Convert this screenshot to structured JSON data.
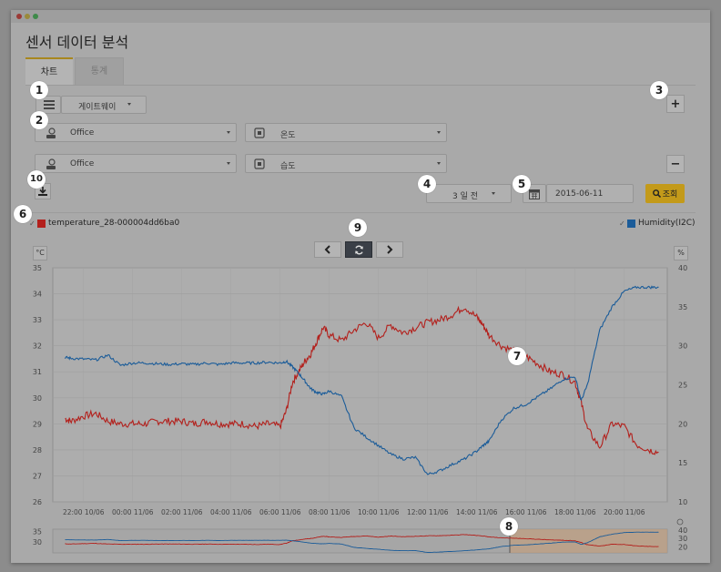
{
  "page": {
    "title": "센서 데이터 분석"
  },
  "tabs": [
    {
      "label": "차트"
    },
    {
      "label": "통계"
    }
  ],
  "toolbar": {
    "gateway_label": "게이트웨이",
    "add_label": "+",
    "remove_label": "−",
    "period_label": "3 일 전",
    "date_value": "2015-06-11",
    "query_label": "조회"
  },
  "series_selectors": [
    {
      "location": "Office",
      "measure": "온도"
    },
    {
      "location": "Office",
      "measure": "습도"
    }
  ],
  "badges": {
    "b1": "1",
    "b2": "2",
    "b3": "3",
    "b4": "4",
    "b5": "5",
    "b6": "6",
    "b7": "7",
    "b8": "8",
    "b9": "9",
    "b10": "10"
  },
  "legend": {
    "left": {
      "name": "temperature_28-000004dd6ba0",
      "color": "#c0201f",
      "checked": true
    },
    "right": {
      "name": "Humidity(I2C)",
      "color": "#1f5f9e",
      "checked": true
    }
  },
  "axes": {
    "left_unit": "°C",
    "right_unit": "%"
  },
  "colors": {
    "accent": "#d7a81b",
    "temperature": "#b3201c",
    "humidity": "#1b5c99",
    "navigator_highlight": "#c89d74"
  },
  "chart_data": {
    "type": "line",
    "x_ticks": [
      "22:00 10/06",
      "00:00 11/06",
      "02:00 11/06",
      "04:00 11/06",
      "06:00 11/06",
      "08:00 11/06",
      "10:00 11/06",
      "12:00 11/06",
      "14:00 11/06",
      "16:00 11/06",
      "18:00 11/06",
      "20:00 11/06"
    ],
    "y_left": {
      "label": "°C",
      "ticks": [
        26,
        27,
        28,
        29,
        30,
        31,
        32,
        33,
        34,
        35
      ],
      "range": [
        26,
        35
      ]
    },
    "y_right": {
      "label": "%",
      "ticks": [
        10,
        15,
        20,
        25,
        30,
        35,
        40
      ],
      "range": [
        10,
        40
      ]
    },
    "x_hours": [
      21.25,
      21.5,
      22,
      22.5,
      23,
      23.5,
      0,
      0.5,
      1,
      1.5,
      2,
      2.5,
      3,
      3.5,
      4,
      4.5,
      5,
      5.5,
      6,
      6.25,
      6.5,
      6.75,
      7,
      7.25,
      7.5,
      7.75,
      8,
      8.5,
      9,
      9.5,
      10,
      10.5,
      11,
      11.5,
      12,
      12.5,
      13,
      13.5,
      14,
      14.25,
      14.5,
      15,
      15.5,
      16,
      16.5,
      17,
      17.5,
      18,
      18.25,
      18.5,
      19,
      19.5,
      20,
      20.5,
      21,
      21.4
    ],
    "series": [
      {
        "name": "temperature_28-000004dd6ba0",
        "axis": "left",
        "color": "#b3201c",
        "values": [
          29.2,
          29.1,
          29.3,
          29.4,
          29.1,
          29.0,
          29.0,
          29.0,
          29.1,
          29.1,
          29.1,
          29.0,
          29.1,
          29.0,
          29.0,
          29.0,
          28.9,
          29.0,
          28.9,
          29.5,
          30.6,
          31.0,
          31.4,
          31.7,
          32.2,
          32.7,
          32.4,
          32.2,
          32.6,
          32.9,
          32.3,
          32.8,
          32.5,
          32.7,
          32.9,
          33.0,
          33.2,
          33.5,
          33.1,
          32.8,
          32.4,
          32.0,
          31.8,
          31.6,
          31.3,
          31.0,
          30.9,
          30.6,
          29.8,
          28.8,
          28.1,
          29.0,
          28.9,
          28.2,
          28.0,
          27.9
        ]
      },
      {
        "name": "Humidity(I2C)",
        "axis": "right",
        "color": "#1b5c99",
        "values": [
          28.5,
          28.4,
          28.3,
          28.2,
          28.8,
          27.5,
          27.8,
          27.8,
          27.7,
          27.6,
          27.7,
          27.6,
          27.8,
          27.6,
          27.8,
          27.8,
          27.8,
          27.9,
          27.8,
          28.0,
          27.3,
          26.5,
          25.5,
          24.5,
          24.0,
          23.8,
          24.2,
          23.5,
          19.5,
          18.3,
          17.2,
          16.1,
          15.5,
          15.7,
          13.5,
          14.0,
          14.8,
          15.5,
          16.5,
          17.2,
          17.8,
          20.5,
          22.0,
          22.5,
          23.5,
          24.5,
          25.7,
          26.0,
          23.0,
          25.0,
          32.0,
          35.0,
          37.0,
          37.5,
          37.5,
          37.5
        ]
      }
    ],
    "navigator": {
      "left_ticks": [
        30,
        35
      ],
      "right_ticks": [
        20,
        30,
        40
      ]
    },
    "grid": true
  }
}
